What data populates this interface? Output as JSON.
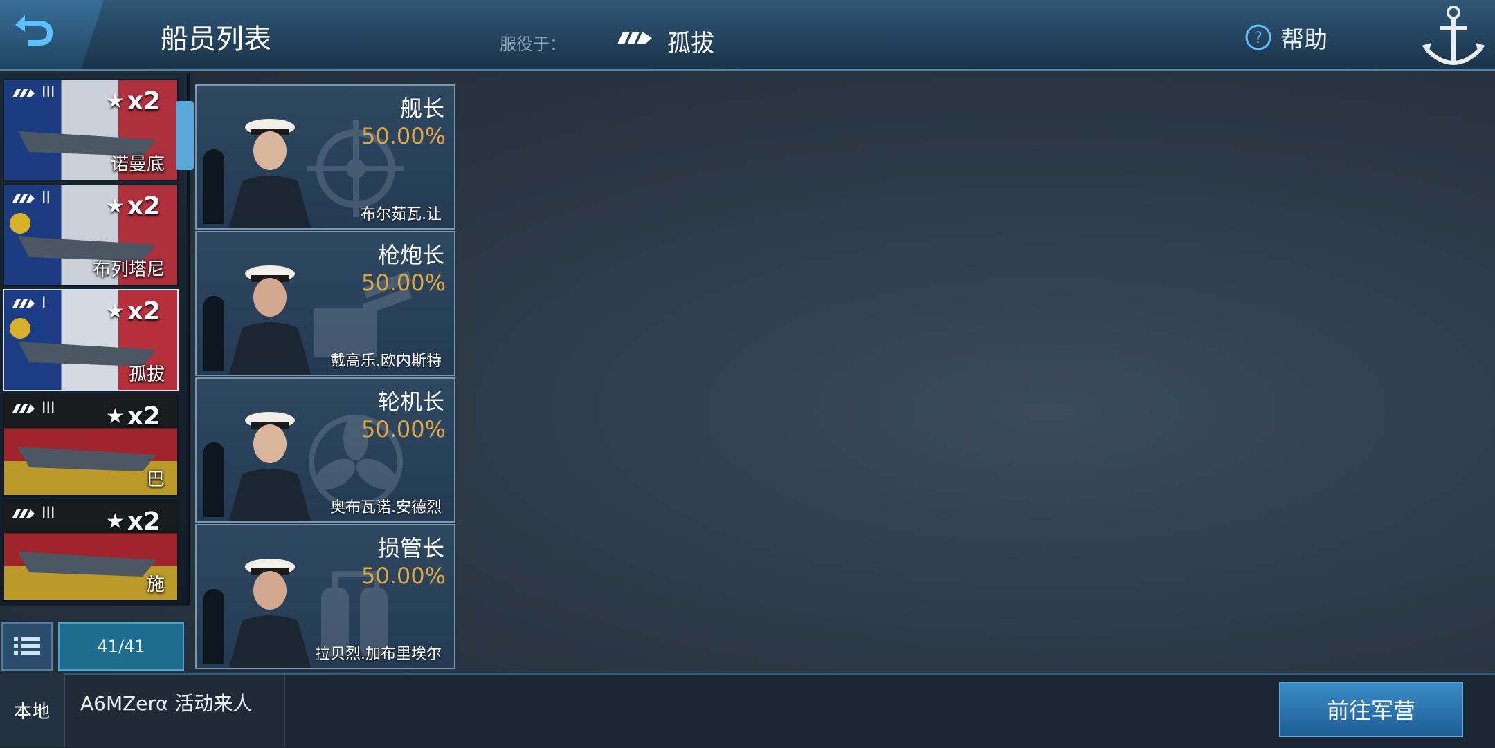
{
  "header": {
    "title": "船员列表",
    "serve_label": "服役于：",
    "serving_ship": "孤拔",
    "help_label": "帮助"
  },
  "ships": [
    {
      "name": "诺曼底",
      "tier": "III",
      "count": "x2",
      "flag_colors": [
        "#1c3f8f",
        "#e8eef5",
        "#c8323d"
      ],
      "selected": false
    },
    {
      "name": "布列塔尼",
      "tier": "II",
      "count": "x2",
      "flag_colors": [
        "#1c3f8f",
        "#e8eef5",
        "#c8323d"
      ],
      "selected": false
    },
    {
      "name": "孤拔",
      "tier": "I",
      "count": "x2",
      "flag_colors": [
        "#1c3f8f",
        "#e8eef5",
        "#c8323d"
      ],
      "selected": true
    },
    {
      "name": "巴",
      "tier": "III",
      "count": "x2",
      "flag_colors": [
        "#1a1a1a",
        "#b8252c",
        "#d9b02a"
      ],
      "selected": false
    },
    {
      "name": "施",
      "tier": "III",
      "count": "x2",
      "flag_colors": [
        "#1a1a1a",
        "#b8252c",
        "#d9b02a"
      ],
      "selected": false
    }
  ],
  "counter": "41/41",
  "crew": [
    {
      "role": "舰长",
      "percent": "50.00%",
      "name": "布尔茹瓦.让",
      "bg_icon": "ship-wheel-icon"
    },
    {
      "role": "枪炮长",
      "percent": "50.00%",
      "name": "戴高乐.欧内斯特",
      "bg_icon": "gun-turret-icon"
    },
    {
      "role": "轮机长",
      "percent": "50.00%",
      "name": "奥布瓦诺.安德烈",
      "bg_icon": "propeller-icon"
    },
    {
      "role": "损管长",
      "percent": "50.00%",
      "name": "拉贝烈.加布里埃尔",
      "bg_icon": "fire-extinguisher-icon"
    }
  ],
  "bottom": {
    "local_tab": "本地",
    "chat_message": "A6MZerα 活动来人",
    "go_button": "前往军营"
  },
  "colors": {
    "accent": "#5aa7da",
    "percent": "#e3a742",
    "header": "#24435e"
  }
}
